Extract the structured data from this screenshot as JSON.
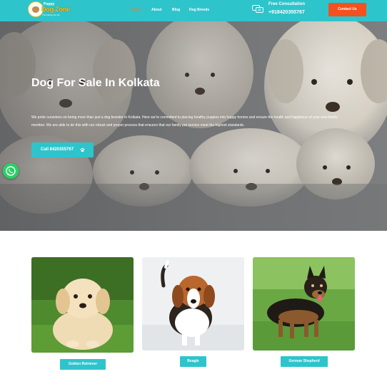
{
  "brand": {
    "logo_top": "Puppy",
    "logo_main": "Dog Zone",
    "logo_sub": "The Family For All",
    "accent": "#2ec4cc",
    "orange": "#f4511e",
    "yellow": "#f3c623"
  },
  "nav": {
    "items": [
      {
        "label": "Home",
        "active": true
      },
      {
        "label": "About"
      },
      {
        "label": "Blog"
      },
      {
        "label": "Dog Breeds"
      }
    ]
  },
  "header": {
    "consult_title": "Free Consultation",
    "consult_phone": "+918420355767",
    "consult_icon": "chat-bubbles-icon",
    "contact_label": "Contact Us"
  },
  "hero": {
    "title": "Dog For Sale In Kolkata",
    "text": "We pride ourselves on being more than just a dog breeder in Kolkata. Here we're committed to placing healthy puppies into happy homes and ensure the health and happiness of your new family member. We are able to do this with our robust and proper process that ensures that our family pet service meet the highest standards.",
    "call_label": "Call 8420355767",
    "call_icon": "paw-icon"
  },
  "whatsapp": {
    "icon": "whatsapp-icon"
  },
  "breeds": [
    {
      "label": "Golden Retriever"
    },
    {
      "label": "Beagle"
    },
    {
      "label": "German Shepherd"
    }
  ]
}
